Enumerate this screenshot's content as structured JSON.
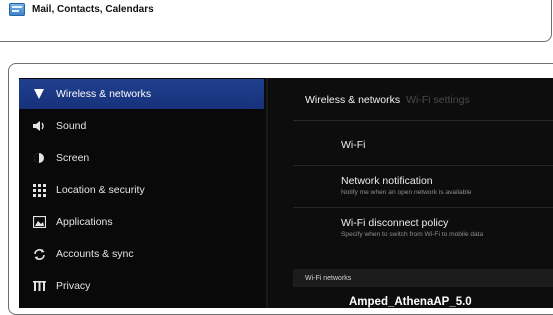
{
  "top": {
    "label": "Mail, Contacts, Calendars",
    "icon": "mail-icon"
  },
  "sidebar": {
    "items": [
      {
        "label": "Wireless & networks",
        "icon": "wifi-icon",
        "active": true
      },
      {
        "label": "Sound",
        "icon": "speaker-icon",
        "active": false
      },
      {
        "label": "Screen",
        "icon": "brightness-icon",
        "active": false
      },
      {
        "label": "Location & security",
        "icon": "grid-lock-icon",
        "active": false
      },
      {
        "label": "Applications",
        "icon": "applications-icon",
        "active": false
      },
      {
        "label": "Accounts & sync",
        "icon": "sync-icon",
        "active": false
      },
      {
        "label": "Privacy",
        "icon": "privacy-icon",
        "active": false
      }
    ],
    "active_color": "#1f3f8e"
  },
  "pane": {
    "breadcrumb": "Wireless & networks",
    "breadcrumb_dim": "Wi-Fi settings",
    "rows": [
      {
        "title": "Wi-Fi",
        "sub": ""
      },
      {
        "title": "Network notification",
        "sub": "Notify me when an open network is available"
      },
      {
        "title": "Wi-Fi disconnect policy",
        "sub": "Specify when to switch from Wi-Fi to mobile data"
      }
    ],
    "section_header": "Wi-Fi networks",
    "network_name": "Amped_AthenaAP_5.0"
  }
}
